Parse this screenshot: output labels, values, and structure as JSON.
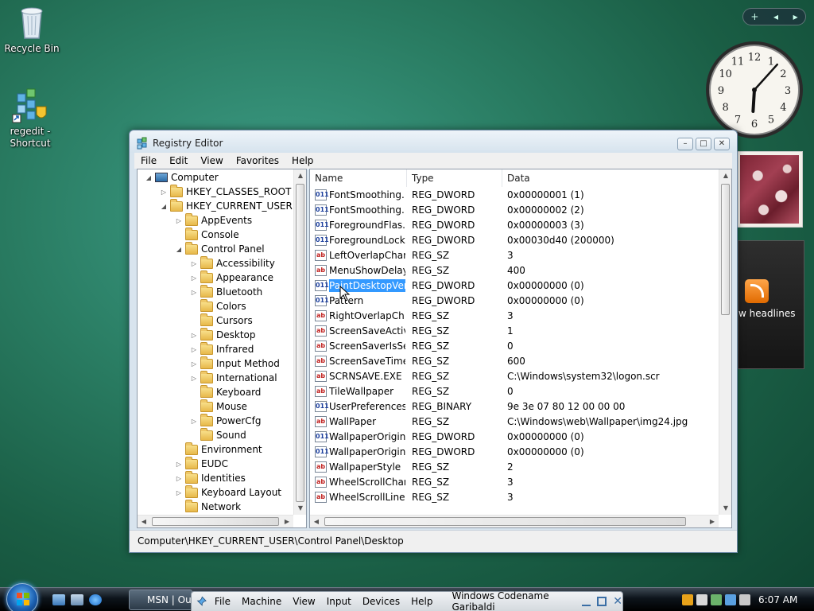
{
  "desktop": {
    "icons": [
      {
        "label": "Recycle Bin",
        "icon": "recycle-bin-icon"
      },
      {
        "label": "regedit -\nShortcut",
        "label_line1": "regedit -",
        "label_line2": "Shortcut",
        "icon": "regedit-icon"
      }
    ]
  },
  "gadgets": {
    "controls": [
      "+",
      "◂",
      "▸"
    ],
    "clock": {
      "hour": 6,
      "minute": 7
    },
    "feed": {
      "text": "w headlines"
    }
  },
  "window": {
    "title": "Registry Editor",
    "buttons": {
      "minimize": "–",
      "maximize": "□",
      "close": "✕"
    },
    "menu": [
      "File",
      "Edit",
      "View",
      "Favorites",
      "Help"
    ],
    "tree": [
      {
        "label": "Computer",
        "level": 0,
        "exp": "◢",
        "icon": "computer"
      },
      {
        "label": "HKEY_CLASSES_ROOT",
        "level": 1,
        "exp": "▷"
      },
      {
        "label": "HKEY_CURRENT_USER",
        "level": 1,
        "exp": "◢"
      },
      {
        "label": "AppEvents",
        "level": 2,
        "exp": "▷"
      },
      {
        "label": "Console",
        "level": 2,
        "exp": ""
      },
      {
        "label": "Control Panel",
        "level": 2,
        "exp": "◢"
      },
      {
        "label": "Accessibility",
        "level": 3,
        "exp": "▷"
      },
      {
        "label": "Appearance",
        "level": 3,
        "exp": "▷"
      },
      {
        "label": "Bluetooth",
        "level": 3,
        "exp": "▷"
      },
      {
        "label": "Colors",
        "level": 3,
        "exp": ""
      },
      {
        "label": "Cursors",
        "level": 3,
        "exp": ""
      },
      {
        "label": "Desktop",
        "level": 3,
        "exp": "▷"
      },
      {
        "label": "Infrared",
        "level": 3,
        "exp": "▷"
      },
      {
        "label": "Input Method",
        "level": 3,
        "exp": "▷"
      },
      {
        "label": "International",
        "level": 3,
        "exp": "▷"
      },
      {
        "label": "Keyboard",
        "level": 3,
        "exp": ""
      },
      {
        "label": "Mouse",
        "level": 3,
        "exp": ""
      },
      {
        "label": "PowerCfg",
        "level": 3,
        "exp": "▷"
      },
      {
        "label": "Sound",
        "level": 3,
        "exp": ""
      },
      {
        "label": "Environment",
        "level": 2,
        "exp": ""
      },
      {
        "label": "EUDC",
        "level": 2,
        "exp": "▷"
      },
      {
        "label": "Identities",
        "level": 2,
        "exp": "▷"
      },
      {
        "label": "Keyboard Layout",
        "level": 2,
        "exp": "▷"
      },
      {
        "label": "Network",
        "level": 2,
        "exp": ""
      }
    ],
    "columns": [
      "Name",
      "Type",
      "Data"
    ],
    "values": [
      {
        "name": "FontSmoothing...",
        "type": "REG_DWORD",
        "data": "0x00000001 (1)",
        "kind": "bin"
      },
      {
        "name": "FontSmoothing...",
        "type": "REG_DWORD",
        "data": "0x00000002 (2)",
        "kind": "bin"
      },
      {
        "name": "ForegroundFlas...",
        "type": "REG_DWORD",
        "data": "0x00000003 (3)",
        "kind": "bin"
      },
      {
        "name": "ForegroundLock...",
        "type": "REG_DWORD",
        "data": "0x00030d40 (200000)",
        "kind": "bin"
      },
      {
        "name": "LeftOverlapChars",
        "type": "REG_SZ",
        "data": "3",
        "kind": "sz"
      },
      {
        "name": "MenuShowDelay",
        "type": "REG_SZ",
        "data": "400",
        "kind": "sz"
      },
      {
        "name": "PaintDesktopVer...",
        "type": "REG_DWORD",
        "data": "0x00000000 (0)",
        "kind": "bin",
        "selected": true
      },
      {
        "name": "Pattern",
        "type": "REG_DWORD",
        "data": "0x00000000 (0)",
        "kind": "bin"
      },
      {
        "name": "RightOverlapCh...",
        "type": "REG_SZ",
        "data": "3",
        "kind": "sz"
      },
      {
        "name": "ScreenSaveActive",
        "type": "REG_SZ",
        "data": "1",
        "kind": "sz"
      },
      {
        "name": "ScreenSaverIsSe...",
        "type": "REG_SZ",
        "data": "0",
        "kind": "sz"
      },
      {
        "name": "ScreenSaveTime...",
        "type": "REG_SZ",
        "data": "600",
        "kind": "sz"
      },
      {
        "name": "SCRNSAVE.EXE",
        "type": "REG_SZ",
        "data": "C:\\Windows\\system32\\logon.scr",
        "kind": "sz"
      },
      {
        "name": "TileWallpaper",
        "type": "REG_SZ",
        "data": "0",
        "kind": "sz"
      },
      {
        "name": "UserPreferences...",
        "type": "REG_BINARY",
        "data": "9e 3e 07 80 12 00 00 00",
        "kind": "bin"
      },
      {
        "name": "WallPaper",
        "type": "REG_SZ",
        "data": "C:\\Windows\\web\\Wallpaper\\img24.jpg",
        "kind": "sz"
      },
      {
        "name": "WallpaperOriginX",
        "type": "REG_DWORD",
        "data": "0x00000000 (0)",
        "kind": "bin"
      },
      {
        "name": "WallpaperOriginY",
        "type": "REG_DWORD",
        "data": "0x00000000 (0)",
        "kind": "bin"
      },
      {
        "name": "WallpaperStyle",
        "type": "REG_SZ",
        "data": "2",
        "kind": "sz"
      },
      {
        "name": "WheelScrollChars",
        "type": "REG_SZ",
        "data": "3",
        "kind": "sz"
      },
      {
        "name": "WheelScrollLines",
        "type": "REG_SZ",
        "data": "3",
        "kind": "sz"
      }
    ],
    "value_icon_text": {
      "sz": "ab",
      "bin": "011"
    },
    "status": "Computer\\HKEY_CURRENT_USER\\Control Panel\\Desktop"
  },
  "taskbar": {
    "task_label": "MSN | Ou",
    "vbox_menu": [
      "File",
      "Machine",
      "View",
      "Input",
      "Devices",
      "Help"
    ],
    "vbox_title": "Windows Codename Garibaldi",
    "time": "6:07 AM"
  }
}
